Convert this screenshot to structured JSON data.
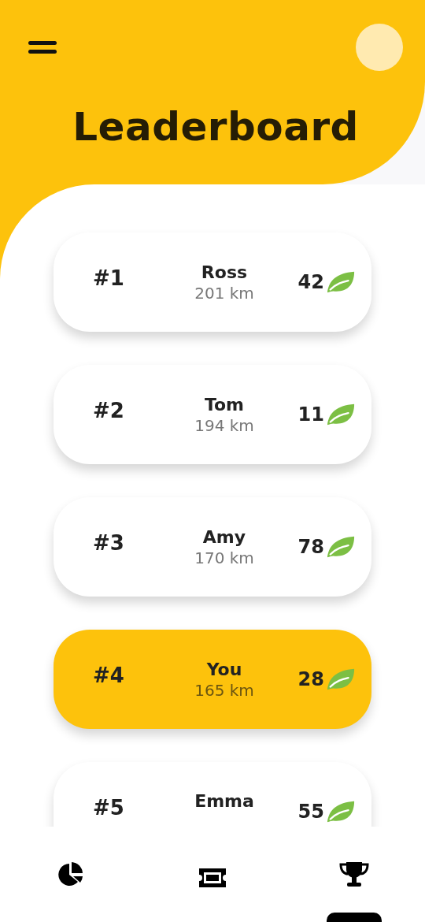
{
  "header": {
    "title": "Leaderboard"
  },
  "leaderboard": [
    {
      "rank": "#1",
      "name": "Ross",
      "distance": "201 km",
      "score": "42",
      "current_user": false
    },
    {
      "rank": "#2",
      "name": "Tom",
      "distance": "194 km",
      "score": "11",
      "current_user": false
    },
    {
      "rank": "#3",
      "name": "Amy",
      "distance": "170 km",
      "score": "78",
      "current_user": false
    },
    {
      "rank": "#4",
      "name": "You",
      "distance": "165 km",
      "score": "28",
      "current_user": true
    },
    {
      "rank": "#5",
      "name": "Emma",
      "score": "55",
      "current_user": false
    }
  ],
  "bottom_nav": [
    {
      "kind": "stats",
      "selected": false
    },
    {
      "kind": "ticket",
      "selected": false
    },
    {
      "kind": "trophy",
      "selected": true
    }
  ]
}
